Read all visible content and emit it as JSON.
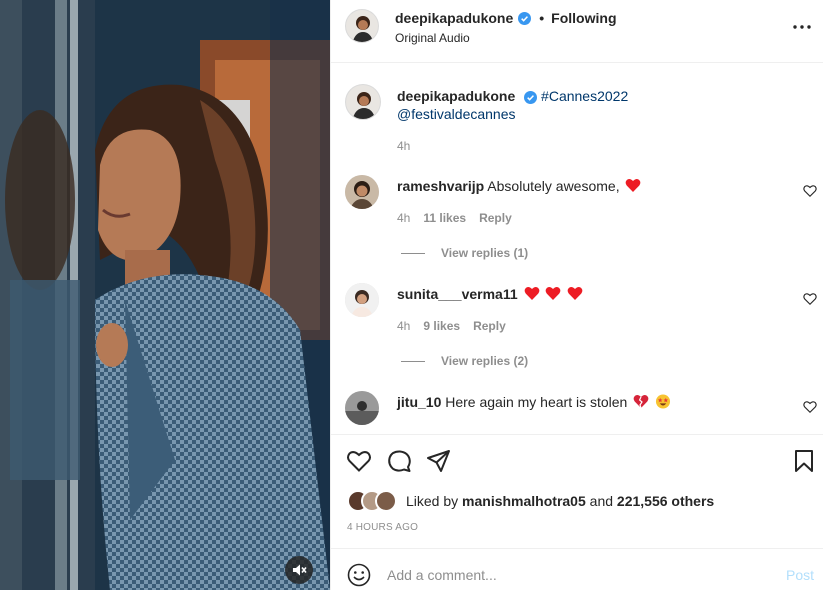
{
  "header": {
    "username": "deepikapadukone",
    "separator": "•",
    "follow_status": "Following",
    "audio": "Original Audio"
  },
  "caption": {
    "username": "deepikapadukone",
    "hashtag": "#Cannes2022",
    "mention": "@festivaldecannes",
    "time": "4h"
  },
  "comments": [
    {
      "username": "rameshvarijp",
      "text": "Absolutely awesome,",
      "emojis": [
        "red-heart"
      ],
      "time": "4h",
      "likes": "11 likes",
      "reply_label": "Reply",
      "view_replies": "View replies (1)"
    },
    {
      "username": "sunita___verma11",
      "text": "",
      "emojis": [
        "red-heart",
        "red-heart",
        "red-heart"
      ],
      "time": "4h",
      "likes": "9 likes",
      "reply_label": "Reply",
      "view_replies": "View replies (2)"
    },
    {
      "username": "jitu_10",
      "text": "Here again my heart is stolen",
      "emojis": [
        "broken-heart",
        "star-struck"
      ]
    }
  ],
  "likes": {
    "prefix": "Liked by",
    "user": "manishmalhotra05",
    "connector": "and",
    "others": "221,556 others"
  },
  "post_time": "4 HOURS AGO",
  "add_comment": {
    "placeholder": "Add a comment...",
    "post_label": "Post"
  },
  "colors": {
    "verified_blue": "#3897f0",
    "link_blue": "#00376b",
    "post_disabled": "#b2dffc",
    "muted_text": "#8e8e8e",
    "heart_red": "#ed1c24"
  }
}
